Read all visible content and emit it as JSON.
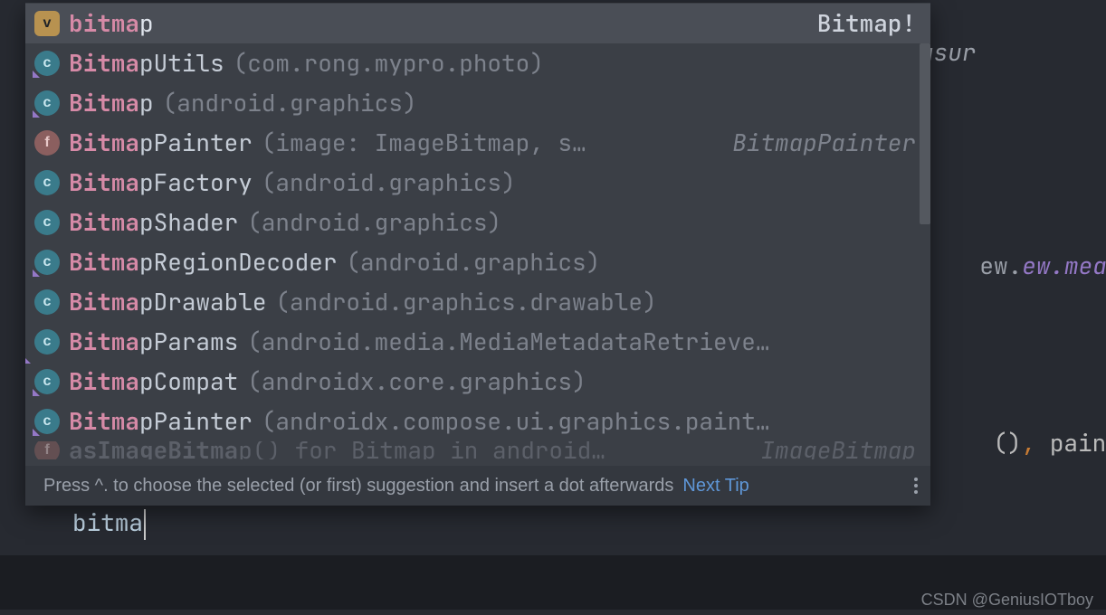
{
  "editor_bg": {
    "line1_tail": ", webview.measur",
    "line6_tail": "ew.measured",
    "line10_tail": "(), paint)"
  },
  "typed": "bitma",
  "popup": {
    "items": [
      {
        "icon": "v",
        "hi": "bitma",
        "rest": "p",
        "loc": "",
        "right": "Bitmap!",
        "selected": true
      },
      {
        "icon": "c-abs",
        "hi": "Bitma",
        "rest": "pUtils",
        "loc": "(com.rong.mypro.photo)",
        "right": ""
      },
      {
        "icon": "c-abs",
        "hi": "Bitma",
        "rest": "p",
        "loc": "(android.graphics)",
        "right": ""
      },
      {
        "icon": "f",
        "hi": "Bitma",
        "rest": "pPainter",
        "loc": "(image: ImageBitmap, s…",
        "right": "BitmapPainter"
      },
      {
        "icon": "c",
        "hi": "Bitma",
        "rest": "pFactory",
        "loc": "(android.graphics)",
        "right": ""
      },
      {
        "icon": "c",
        "hi": "Bitma",
        "rest": "pShader",
        "loc": "(android.graphics)",
        "right": ""
      },
      {
        "icon": "c-abs",
        "hi": "Bitma",
        "rest": "pRegionDecoder",
        "loc": "(android.graphics)",
        "right": ""
      },
      {
        "icon": "c",
        "hi": "Bitma",
        "rest": "pDrawable",
        "loc": "(android.graphics.drawable)",
        "right": ""
      },
      {
        "icon": "c2",
        "hi": "Bitma",
        "rest": "pParams",
        "loc": "(android.media.MediaMetadataRetrieve…",
        "right": ""
      },
      {
        "icon": "c-abs",
        "hi": "Bitma",
        "rest": "pCompat",
        "loc": "(androidx.core.graphics)",
        "right": ""
      },
      {
        "icon": "c-abs",
        "hi": "Bitma",
        "rest": "pPainter",
        "loc": "(androidx.compose.ui.graphics.paint…",
        "right": ""
      },
      {
        "icon": "f",
        "hi": "asImageBitma",
        "rest": "p() for Bitmap in android…",
        "loc": "",
        "right": "ImageBitmap",
        "cutoff": true
      }
    ],
    "footer_tip": "Press ^. to choose the selected (or first) suggestion and insert a dot afterwards",
    "footer_link": "Next Tip"
  },
  "watermark": "CSDN @GeniusIOTboy"
}
